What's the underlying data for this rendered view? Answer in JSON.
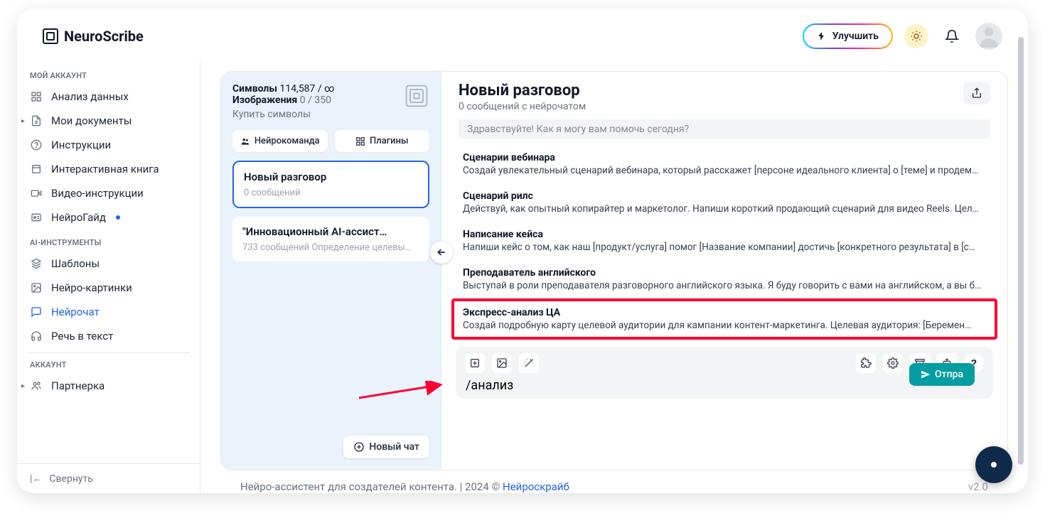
{
  "brand": {
    "name_a": "Neuro",
    "name_b": "Scribe"
  },
  "top": {
    "upgrade": "Улучшить"
  },
  "sidebar": {
    "sections": {
      "account": "МОЙ АККАУНТ",
      "ai_tools": "AI-ИНСТРУМЕНТЫ",
      "acct2": "АККАУНТ"
    },
    "items": {
      "analytics": "Анализ данных",
      "documents": "Мои документы",
      "instructions": "Инструкции",
      "interactive_book": "Интерактивная книга",
      "video_instr": "Видео-инструкции",
      "neuroguide": "НейроГайд",
      "templates": "Шаблоны",
      "neuro_images": "Нейро-картинки",
      "neurochat": "Нейрочат",
      "speech_to_text": "Речь в текст",
      "partner": "Партнерка"
    },
    "collapse": "Свернуть"
  },
  "stats": {
    "symbols_label": "Символы",
    "symbols_value": "114,587 / ∞",
    "images_label": "Изображения",
    "images_value": "0 / 350",
    "buy": "Купить символы"
  },
  "panel_tabs": {
    "team": "Нейрокоманда",
    "plugins": "Плагины"
  },
  "conversations": [
    {
      "title": "Новый разговор",
      "sub": "0 сообщений",
      "active": true
    },
    {
      "title": "\"Инновационный AI-ассист…",
      "sub": "733 сообщений Определение целевы…",
      "active": false
    }
  ],
  "new_chat": "Новый чат",
  "chat": {
    "title": "Новый разговор",
    "subtitle": "0 сообщений с нейрочатом",
    "greeting_truncated": "Здравствуйте! Как я могу вам помочь сегодня?"
  },
  "suggestions": [
    {
      "title": "Сценарии вебинара",
      "desc": "Создай увлекательный сценарий вебинара, который расскажет [персоне идеального клиента] о [теме] и продем…"
    },
    {
      "title": "Сценарий рилс",
      "desc": "Действуй, как опытный копирайтер и маркетолог. Напиши короткий продающий сценарий для видео Reels. Цел…"
    },
    {
      "title": "Написание кейса",
      "desc": "Напиши кейс о том, как наш [продукт/услуга] помог [Название компании] достичь [конкретного результата] в [с…"
    },
    {
      "title": "Преподаватель английского",
      "desc": "Выступай в роли преподавателя разговорного английского языка. Я буду говорить с вами на английском, а вы б…"
    },
    {
      "title": "Экспресс-анализ ЦА",
      "desc": "Создай подробную карту целевой аудитории для кампании контент-маркетинга. Целевая аудитория: [Беремен…",
      "highlight": true
    }
  ],
  "input": {
    "value": "/анализ",
    "send": "Отправить"
  },
  "footer": {
    "text_a": "Нейро-ассистент для создателей контента.  | 2024 © ",
    "link": "Нейроскрайб",
    "version": "v2.0"
  }
}
